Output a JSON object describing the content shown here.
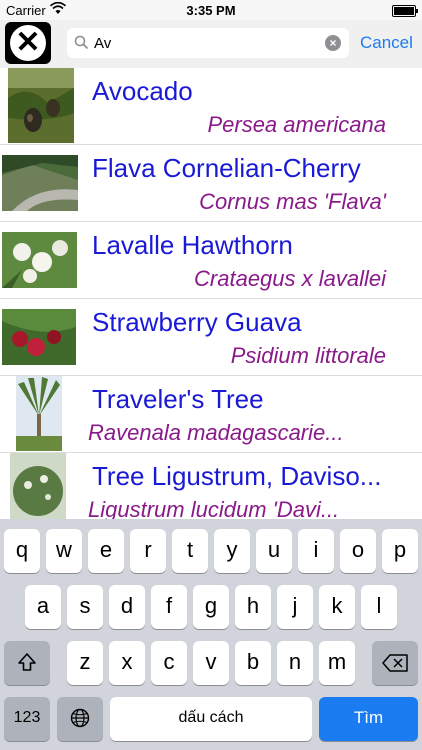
{
  "status": {
    "carrier": "Carrier",
    "time": "3:35 PM"
  },
  "search": {
    "value": "Av",
    "cancel_label": "Cancel"
  },
  "results": [
    {
      "name": "Avocado",
      "latin": "Persea americana"
    },
    {
      "name": "Flava Cornelian-Cherry",
      "latin": "Cornus mas 'Flava'"
    },
    {
      "name": "Lavalle Hawthorn",
      "latin": "Crataegus x lavallei"
    },
    {
      "name": "Strawberry Guava",
      "latin": "Psidium littorale"
    },
    {
      "name": "Traveler's Tree",
      "latin": "Ravenala madagascarie..."
    },
    {
      "name": "Tree Ligustrum, Daviso...",
      "latin": "Ligustrum lucidum 'Davi..."
    }
  ],
  "keyboard": {
    "row1": [
      "q",
      "w",
      "e",
      "r",
      "t",
      "y",
      "u",
      "i",
      "o",
      "p"
    ],
    "row2": [
      "a",
      "s",
      "d",
      "f",
      "g",
      "h",
      "j",
      "k",
      "l"
    ],
    "row3": [
      "z",
      "x",
      "c",
      "v",
      "b",
      "n",
      "m"
    ],
    "numbers_label": "123",
    "space_label": "dấu cách",
    "search_label": "Tìm"
  },
  "colors": {
    "accent": "#1a7cf0",
    "name_text": "#1a1ad6",
    "latin_text": "#8a1a8a",
    "keyboard_bg": "#d1d4da"
  }
}
